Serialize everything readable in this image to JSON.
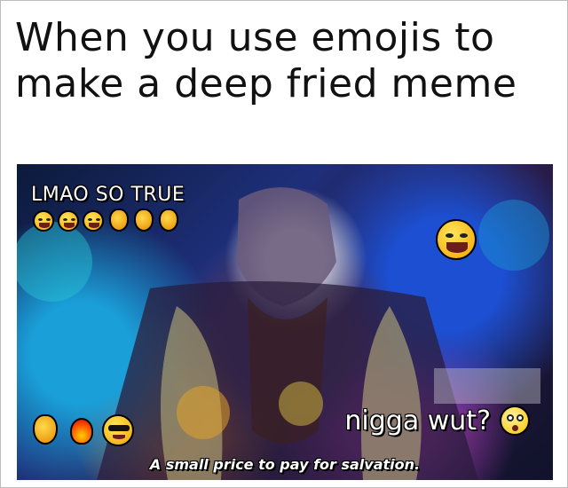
{
  "caption": {
    "line1": "When you use emojis to",
    "line2": "make a deep fried meme"
  },
  "image": {
    "top_text": "LMAO SO TRUE",
    "side_text": "nigga wut?",
    "subtitle": "A small price to pay for salvation.",
    "top_emojis": [
      "laughing-crying-face-icon",
      "laughing-crying-face-icon",
      "laughing-crying-face-icon",
      "ok-hand-icon",
      "ok-hand-icon",
      "ok-hand-icon"
    ],
    "right_emoji": "laughing-crying-face-icon",
    "bottom_left_emojis": [
      "ok-hand-icon",
      "fire-icon",
      "sunglasses-face-icon"
    ],
    "side_emoji": "shocked-face-icon"
  },
  "colors": {
    "caption_text": "#111111",
    "overlay_text": "#ffffff",
    "emoji_yellow": "#f2a300"
  }
}
